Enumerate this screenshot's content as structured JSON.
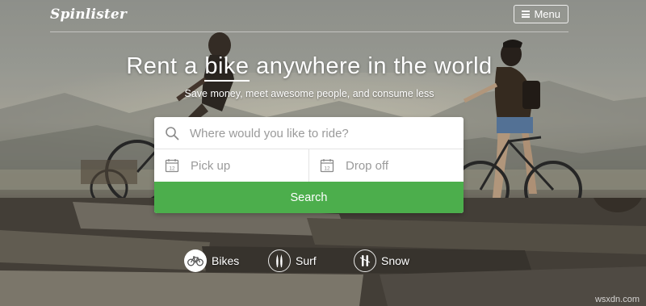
{
  "nav": {
    "logo": "Spinlister",
    "menu_label": "Menu",
    "menu_icon": "hamburger-icon"
  },
  "hero": {
    "headline_pre": "Rent a ",
    "headline_accent": "bike",
    "headline_post": " anywhere in the world",
    "subline": "Save money, meet awesome people, and consume less"
  },
  "search": {
    "where_placeholder": "Where would you like to ride?",
    "where_value": "",
    "pickup_placeholder": "Pick up",
    "dropoff_placeholder": "Drop off",
    "calendar_day": "12",
    "search_label": "Search",
    "search_icon": "search-icon",
    "calendar_icon": "calendar-icon"
  },
  "categories": [
    {
      "label": "Bikes",
      "icon": "bike-icon",
      "active": true
    },
    {
      "label": "Surf",
      "icon": "surfboard-icon",
      "active": false
    },
    {
      "label": "Snow",
      "icon": "ski-icon",
      "active": false
    }
  ],
  "watermark": "wsxdn.com",
  "colors": {
    "accent_green": "#4cae4c",
    "text_white": "#ffffff",
    "placeholder_gray": "#9a9a9a"
  }
}
